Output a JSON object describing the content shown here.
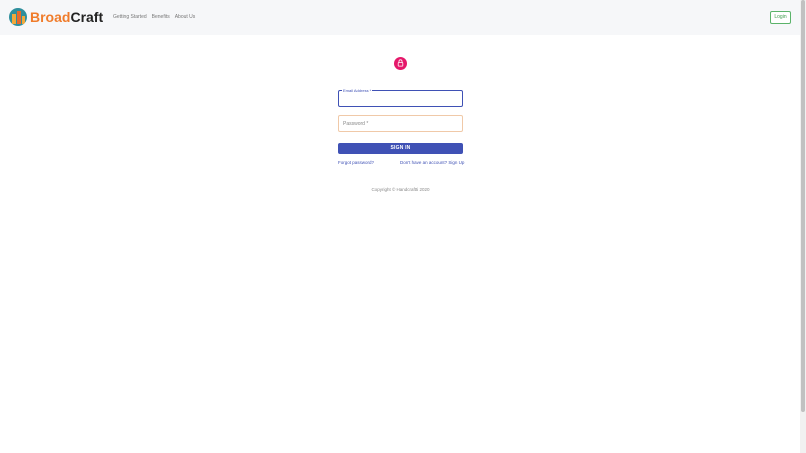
{
  "header": {
    "brand": {
      "part1": "Broad",
      "part2": "Craft",
      "logo_icon": "buildings-logo-icon"
    },
    "nav": [
      {
        "label": "Getting Started"
      },
      {
        "label": "Benefits"
      },
      {
        "label": "About Us"
      }
    ],
    "login_label": "Login"
  },
  "form": {
    "avatar_icon": "lock-icon",
    "email": {
      "label": "Email Address *",
      "value": ""
    },
    "password": {
      "placeholder": "Password *",
      "value": ""
    },
    "submit_label": "SIGN IN",
    "forgot_label": "Forgot password?",
    "signup_label": "Don't have an account? Sign Up"
  },
  "footer": {
    "copyright": "Copyright © Handcraftti 2020"
  },
  "colors": {
    "brand_orange": "#f07c2b",
    "primary": "#3f51b5",
    "lock_pink": "#e5186a",
    "login_green": "#3c9a4c"
  }
}
